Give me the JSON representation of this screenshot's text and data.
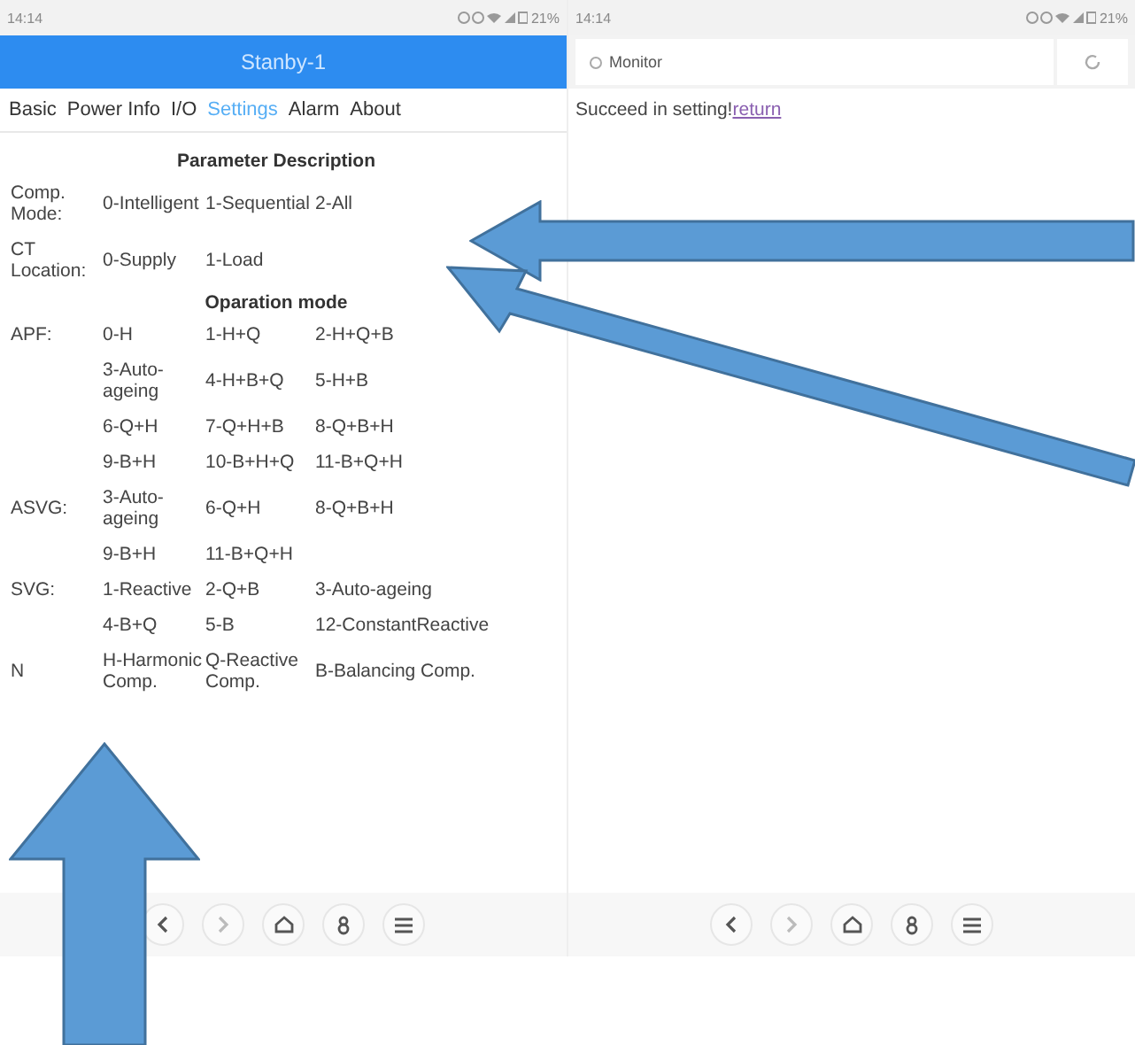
{
  "left_screen": {
    "status_bar": {
      "time": "14:14",
      "battery": "21%"
    },
    "header": {
      "title": "Stanby-1"
    },
    "tabs": [
      {
        "label": "Basic",
        "selected": false
      },
      {
        "label": "Power Info",
        "selected": false
      },
      {
        "label": "I/O",
        "selected": false
      },
      {
        "label": "Settings",
        "selected": true
      },
      {
        "label": "Alarm",
        "selected": false
      },
      {
        "label": "About",
        "selected": false
      }
    ],
    "sections": [
      {
        "title": "Parameter Description",
        "rows": [
          {
            "label": "Comp. Mode:",
            "values": [
              "0-Intelligent",
              "1-Sequential",
              "2-All"
            ]
          },
          {
            "label": "CT Location:",
            "values": [
              "0-Supply",
              "1-Load"
            ]
          }
        ]
      },
      {
        "title": "Oparation mode",
        "rows": [
          {
            "label": "APF:",
            "values": [
              "0-H",
              "1-H+Q",
              "2-H+Q+B"
            ]
          },
          {
            "label": "",
            "values": [
              "3-Auto-ageing",
              "4-H+B+Q",
              "5-H+B"
            ]
          },
          {
            "label": "",
            "values": [
              "6-Q+H",
              "7-Q+H+B",
              "8-Q+B+H"
            ]
          },
          {
            "label": "",
            "values": [
              "9-B+H",
              "10-B+H+Q",
              "11-B+Q+H"
            ]
          },
          {
            "label": "ASVG:",
            "values": [
              "3-Auto-ageing",
              "6-Q+H",
              "8-Q+B+H"
            ]
          },
          {
            "label": "",
            "values": [
              "9-B+H",
              "11-B+Q+H"
            ]
          },
          {
            "label": "SVG:",
            "values": [
              "1-Reactive",
              "2-Q+B",
              "3-Auto-ageing"
            ]
          },
          {
            "label": "",
            "values": [
              "4-B+Q",
              "5-B",
              "12-ConstantReactive"
            ]
          },
          {
            "label": "N",
            "values": [
              "H-Harmonic Comp.",
              "Q-Reactive Comp.",
              "B-Balancing Comp."
            ]
          }
        ]
      }
    ]
  },
  "right_screen": {
    "status_bar": {
      "time": "14:14",
      "battery": "21%"
    },
    "address_field": {
      "value": "Monitor"
    },
    "message": {
      "text": "Succeed in setting!",
      "link": "return"
    }
  }
}
